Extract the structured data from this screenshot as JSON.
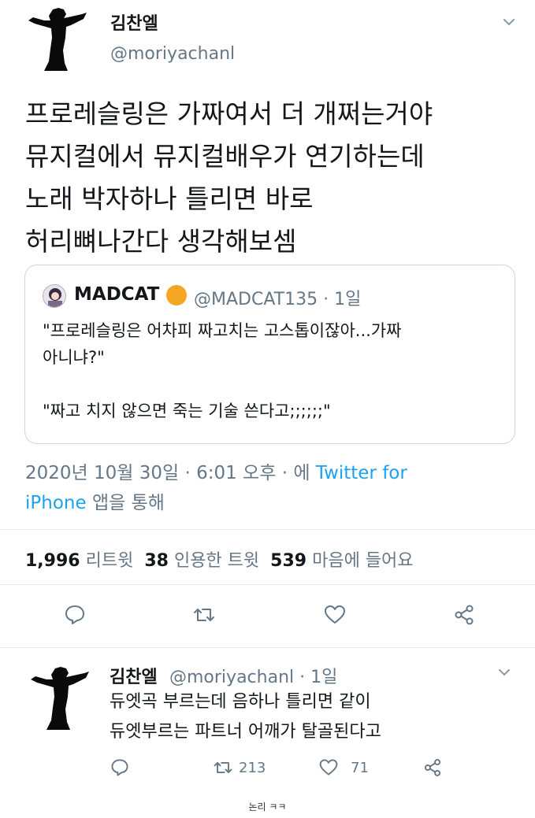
{
  "main_tweet": {
    "name": "김찬엘",
    "handle": "@moriyachanl",
    "text_lines": [
      "프로레슬링은 가짜여서 더 개쩌는거야",
      "뮤지컬에서 뮤지컬배우가 연기하는데",
      "노래 박자하나 틀리면 바로",
      "허리뼈나간다 생각해보셈"
    ],
    "quote": {
      "name": "MADCAT",
      "handle_date": "@MADCAT135 · 1일",
      "text": "\"프로레슬링은 어차피 짜고치는 고스톱이잖아...가짜\n아니냐?\"\n\n\"짜고 치지 않으면 죽는 기술 쓴다고;;;;;;\""
    },
    "meta_prefix": "2020년 10월 30일 · 6:01 오후 · 에 ",
    "meta_source": "Twitter for iPhone",
    "meta_suffix": " 앱을 통해",
    "stats": {
      "retweets_count": "1,996",
      "retweets_label": "리트윗",
      "quotes_count": "38",
      "quotes_label": "인용한 트윗",
      "likes_count": "539",
      "likes_label": "마음에 들어요"
    }
  },
  "reply_tweet": {
    "name": "김찬엘",
    "handle_date": "@moriyachanl · 1일",
    "text_lines": [
      "듀엣곡 부르는데 음하나 틀리면 같이",
      "듀엣부르는 파트너 어깨가 탈골된다고"
    ],
    "retweet_count": "213",
    "like_count": "71"
  },
  "caption": "논리 ㅋㅋ",
  "colors": {
    "text": "#14171a",
    "secondary": "#657786",
    "link": "#1da1f2",
    "border": "#ccd6dd",
    "emoji": "#f5a623"
  },
  "icons": [
    "silhouette-avatar",
    "chevron-down-icon",
    "reply-icon",
    "retweet-icon",
    "heart-icon",
    "share-icon",
    "orange-emoji-icon"
  ]
}
